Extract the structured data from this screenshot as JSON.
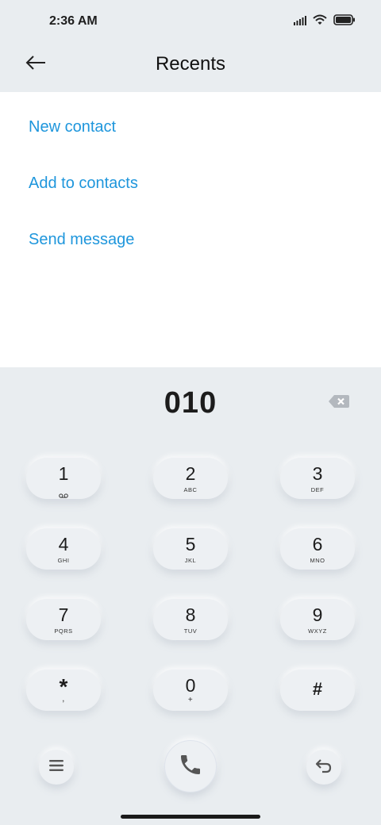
{
  "status_bar": {
    "time": "2:36 AM",
    "icons": [
      "signal-icon",
      "wifi-icon",
      "battery-icon"
    ]
  },
  "header": {
    "title": "Recents",
    "back_icon": "back-arrow-icon"
  },
  "options": [
    {
      "label": "New contact"
    },
    {
      "label": "Add to contacts"
    },
    {
      "label": "Send message"
    }
  ],
  "dialer": {
    "number": "010",
    "backspace_icon": "backspace-icon"
  },
  "keypad": [
    {
      "digit": "1",
      "letters": "",
      "icon": "voicemail-icon"
    },
    {
      "digit": "2",
      "letters": "ABC"
    },
    {
      "digit": "3",
      "letters": "DEF"
    },
    {
      "digit": "4",
      "letters": "GHI"
    },
    {
      "digit": "5",
      "letters": "JKL"
    },
    {
      "digit": "6",
      "letters": "MNO"
    },
    {
      "digit": "7",
      "letters": "PQRS"
    },
    {
      "digit": "8",
      "letters": "TUV"
    },
    {
      "digit": "9",
      "letters": "WXYZ"
    },
    {
      "digit": "*",
      "letters": ","
    },
    {
      "digit": "0",
      "letters": "+"
    },
    {
      "digit": "#",
      "letters": ""
    }
  ],
  "actions": {
    "menu_icon": "menu-icon",
    "call_icon": "phone-icon",
    "undo_icon": "undo-icon"
  },
  "colors": {
    "accent": "#1e96dc",
    "background": "#e9edf0",
    "panel": "#ffffff"
  }
}
